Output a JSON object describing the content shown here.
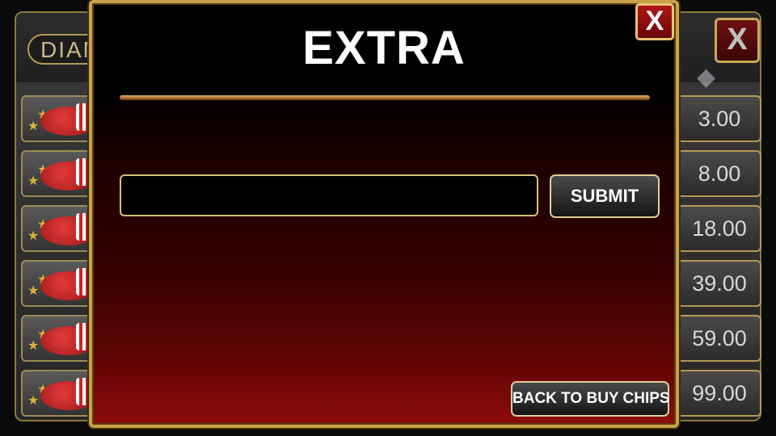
{
  "background_shop": {
    "tab_label": "DIAMONDS",
    "close_label": "X",
    "rows": [
      {
        "price": "3.00"
      },
      {
        "price": "8.00"
      },
      {
        "price": "18.00"
      },
      {
        "price": "39.00"
      },
      {
        "price": "59.00"
      },
      {
        "price": "99.00"
      }
    ]
  },
  "modal": {
    "title": "EXTRA",
    "close_label": "X",
    "code_input": {
      "value": "",
      "placeholder": ""
    },
    "submit_label": "SUBMIT",
    "back_label": "BACK TO BUY CHIPS"
  },
  "colors": {
    "gold_border": "#c9a14a",
    "close_red": "#b01616",
    "gradient_bottom": "#8c0a0a"
  }
}
